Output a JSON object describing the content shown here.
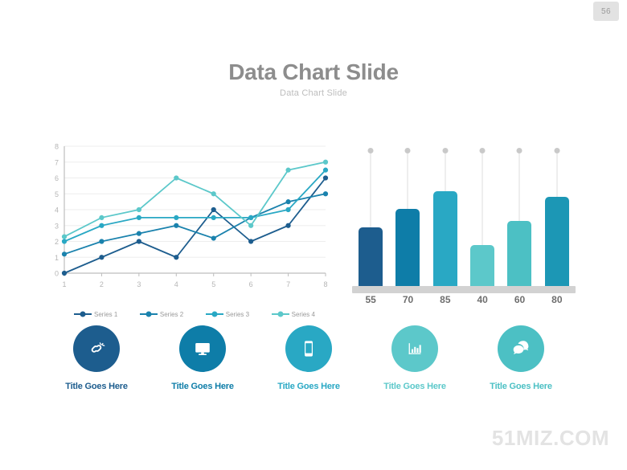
{
  "page_badge": "56",
  "header": {
    "title": "Data Chart Slide",
    "subtitle": "Data Chart Slide"
  },
  "watermark": "51MIZ.COM",
  "colors": {
    "series1": "#1d5d8e",
    "series2": "#1a82ad",
    "series3": "#29a8c4",
    "series4": "#5cc8ca",
    "bar1": "#1d5d8e",
    "bar2": "#0e7da8",
    "bar3": "#29a8c4",
    "bar4": "#5cc8ca",
    "bar5": "#4cc0c4",
    "bar6": "#1c97b5",
    "title_gray": "#8d8d8d",
    "subtitle_gray": "#bdbdbd",
    "axis_gray": "#b5b5b5",
    "watermark_gray": "#e3e3e3"
  },
  "legend": [
    {
      "label": "Series 1",
      "color": "#1d5d8e"
    },
    {
      "label": "Series 2",
      "color": "#1a82ad"
    },
    {
      "label": "Series 3",
      "color": "#29a8c4"
    },
    {
      "label": "Series 4",
      "color": "#5cc8ca"
    }
  ],
  "icons": [
    {
      "name": "broken-link-icon",
      "title": "Title Goes Here",
      "circle_color": "#1d5d8e",
      "title_color": "#1d5d8e"
    },
    {
      "name": "monitor-icon",
      "title": "Title Goes Here",
      "circle_color": "#0e7da8",
      "title_color": "#0e7da8"
    },
    {
      "name": "smartphone-icon",
      "title": "Title Goes Here",
      "circle_color": "#29a8c4",
      "title_color": "#29a8c4"
    },
    {
      "name": "bar-chart-icon",
      "title": "Title Goes Here",
      "circle_color": "#5cc8ca",
      "title_color": "#5cc8ca"
    },
    {
      "name": "speech-bubbles-icon",
      "title": "Title Goes Here",
      "circle_color": "#4cc0c4",
      "title_color": "#4cc0c4"
    }
  ],
  "chart_data": [
    {
      "type": "line",
      "title": "",
      "xlabel": "",
      "ylabel": "",
      "x": [
        1,
        2,
        3,
        4,
        5,
        6,
        7,
        8
      ],
      "xlim": [
        1,
        8
      ],
      "ylim": [
        0,
        8
      ],
      "yticks": [
        0,
        1,
        2,
        3,
        4,
        5,
        6,
        7,
        8
      ],
      "xticks": [
        1,
        2,
        3,
        4,
        5,
        6,
        7,
        8
      ],
      "grid": true,
      "legend_position": "bottom",
      "markers": true,
      "series": [
        {
          "name": "Series 1",
          "color": "#1d5d8e",
          "values": [
            0,
            1,
            2,
            1,
            4,
            2,
            3,
            6
          ]
        },
        {
          "name": "Series 2",
          "color": "#1a82ad",
          "values": [
            1.2,
            2,
            2.5,
            3,
            2.2,
            3.5,
            4.5,
            5
          ]
        },
        {
          "name": "Series 3",
          "color": "#29a8c4",
          "values": [
            2,
            3,
            3.5,
            3.5,
            3.5,
            3.5,
            4,
            6.5
          ]
        },
        {
          "name": "Series 4",
          "color": "#5cc8ca",
          "values": [
            2.3,
            3.5,
            4,
            6,
            5,
            3,
            6.5,
            7
          ]
        }
      ]
    },
    {
      "type": "bar",
      "title": "",
      "xlabel": "",
      "ylabel": "",
      "categories": [
        "55",
        "70",
        "85",
        "40",
        "60",
        "80"
      ],
      "values": [
        55,
        70,
        85,
        40,
        60,
        80
      ],
      "ylim": [
        0,
        100
      ],
      "grid": false,
      "bar_colors": [
        "#1d5d8e",
        "#0e7da8",
        "#29a8c4",
        "#5cc8ca",
        "#4cc0c4",
        "#1c97b5"
      ],
      "has_marker_dots": true
    }
  ]
}
